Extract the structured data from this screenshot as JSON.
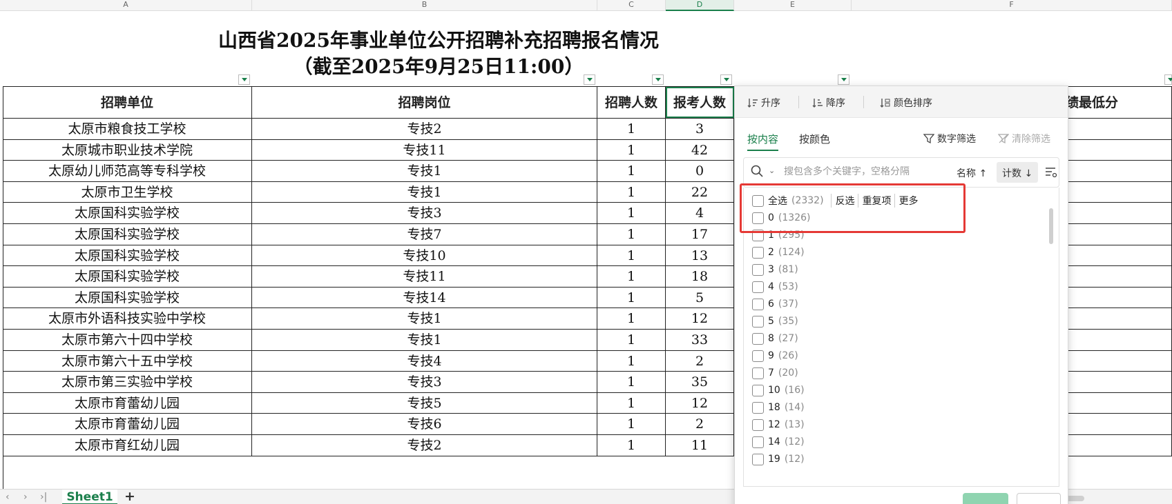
{
  "columns": [
    {
      "letter": "A",
      "header": "招聘单位"
    },
    {
      "letter": "B",
      "header": "招聘岗位"
    },
    {
      "letter": "C",
      "header": "招聘人数"
    },
    {
      "letter": "D",
      "header": "报考人数"
    },
    {
      "letter": "E",
      "header": ""
    },
    {
      "letter": "F",
      "header": "绩最低分"
    }
  ],
  "title": {
    "line1": "山西省2025年事业单位公开招聘补充招聘报名情况",
    "line2": "（截至2025年9月25日11:00）"
  },
  "rows": [
    [
      "太原市粮食技工学校",
      "专技2",
      "1",
      "3"
    ],
    [
      "太原城市职业技术学院",
      "专技11",
      "1",
      "42"
    ],
    [
      "太原幼儿师范高等专科学校",
      "专技1",
      "1",
      "0"
    ],
    [
      "太原市卫生学校",
      "专技1",
      "1",
      "22"
    ],
    [
      "太原国科实验学校",
      "专技3",
      "1",
      "4"
    ],
    [
      "太原国科实验学校",
      "专技7",
      "1",
      "17"
    ],
    [
      "太原国科实验学校",
      "专技10",
      "1",
      "13"
    ],
    [
      "太原国科实验学校",
      "专技11",
      "1",
      "18"
    ],
    [
      "太原国科实验学校",
      "专技14",
      "1",
      "5"
    ],
    [
      "太原市外语科技实验中学校",
      "专技1",
      "1",
      "12"
    ],
    [
      "太原市第六十四中学校",
      "专技1",
      "1",
      "33"
    ],
    [
      "太原市第六十五中学校",
      "专技4",
      "1",
      "2"
    ],
    [
      "太原市第三实验中学校",
      "专技3",
      "1",
      "35"
    ],
    [
      "太原市育蕾幼儿园",
      "专技5",
      "1",
      "12"
    ],
    [
      "太原市育蕾幼儿园",
      "专技6",
      "1",
      "2"
    ],
    [
      "太原市育红幼儿园",
      "专技2",
      "1",
      "11"
    ]
  ],
  "sheet_tabs": {
    "active": "Sheet1",
    "add": "+"
  },
  "filter_panel": {
    "sort_asc": "升序",
    "sort_desc": "降序",
    "sort_color": "颜色排序",
    "tab_content": "按内容",
    "tab_color": "按颜色",
    "number_filter": "数字筛选",
    "clear_filter": "清除筛选",
    "search_placeholder": "搜包含多个关键字，空格分隔",
    "sort_by_name": "名称",
    "sort_by_count": "计数",
    "select_all": "全选",
    "select_all_count": "(2332)",
    "invert": "反选",
    "duplicates": "重复项",
    "more": "更多",
    "items": [
      {
        "value": "0",
        "count": "(1326)"
      },
      {
        "value": "1",
        "count": "(295)"
      },
      {
        "value": "2",
        "count": "(124)"
      },
      {
        "value": "3",
        "count": "(81)"
      },
      {
        "value": "4",
        "count": "(53)"
      },
      {
        "value": "6",
        "count": "(37)"
      },
      {
        "value": "5",
        "count": "(35)"
      },
      {
        "value": "8",
        "count": "(27)"
      },
      {
        "value": "9",
        "count": "(26)"
      },
      {
        "value": "7",
        "count": "(20)"
      },
      {
        "value": "10",
        "count": "(16)"
      },
      {
        "value": "18",
        "count": "(14)"
      },
      {
        "value": "12",
        "count": "(13)"
      },
      {
        "value": "14",
        "count": "(12)"
      },
      {
        "value": "19",
        "count": "(12)"
      }
    ]
  },
  "colors": {
    "accent": "#1a7f4b",
    "highlight": "#e53935"
  }
}
